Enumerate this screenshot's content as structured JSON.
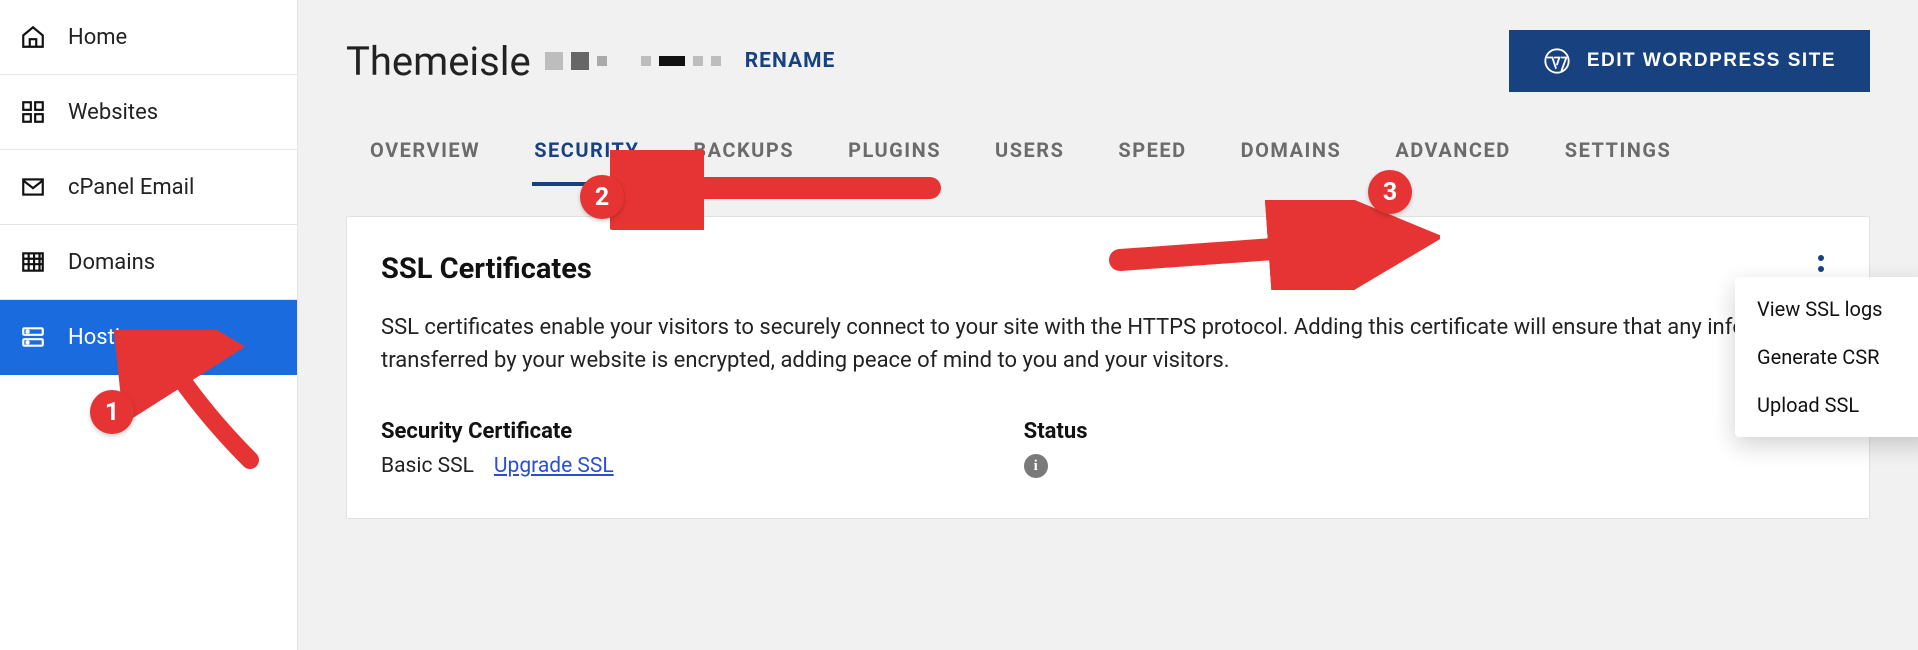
{
  "sidebar": {
    "items": [
      {
        "label": "Home",
        "icon": "home-icon"
      },
      {
        "label": "Websites",
        "icon": "grid-icon"
      },
      {
        "label": "cPanel Email",
        "icon": "mail-icon"
      },
      {
        "label": "Domains",
        "icon": "domains-icon"
      },
      {
        "label": "Hosting",
        "icon": "hosting-icon",
        "active": true
      }
    ]
  },
  "header": {
    "site_name": "Themeisle",
    "rename_label": "RENAME",
    "edit_button": "EDIT WORDPRESS SITE"
  },
  "tabs": [
    {
      "label": "OVERVIEW"
    },
    {
      "label": "SECURITY",
      "active": true
    },
    {
      "label": "BACKUPS"
    },
    {
      "label": "PLUGINS"
    },
    {
      "label": "USERS"
    },
    {
      "label": "SPEED"
    },
    {
      "label": "DOMAINS"
    },
    {
      "label": "ADVANCED"
    },
    {
      "label": "SETTINGS"
    }
  ],
  "ssl_card": {
    "title": "SSL Certificates",
    "description": "SSL certificates enable your visitors to securely connect to your site with the HTTPS protocol. Adding this certificate will ensure that any information transferred by your website is encrypted, adding peace of mind to you and your visitors.",
    "cert_label": "Security Certificate",
    "cert_value": "Basic SSL",
    "upgrade_link": "Upgrade SSL",
    "status_label": "Status",
    "menu": [
      {
        "label": "View SSL logs"
      },
      {
        "label": "Generate CSR"
      },
      {
        "label": "Upload SSL"
      }
    ]
  },
  "annotations": {
    "badge1": "1",
    "badge2": "2",
    "badge3": "3"
  }
}
